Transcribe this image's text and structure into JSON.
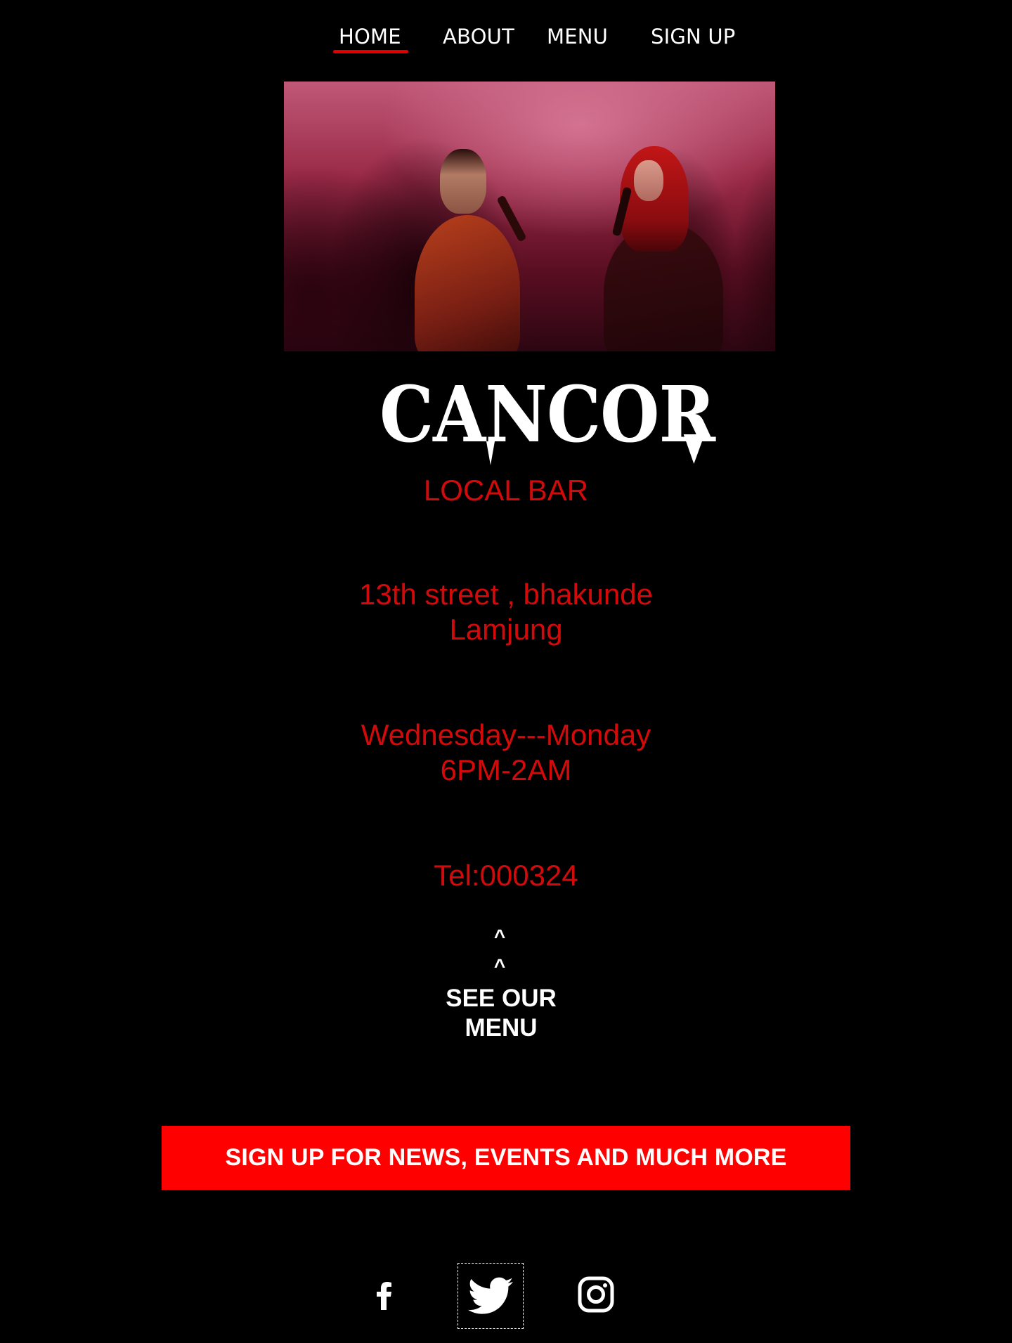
{
  "nav": {
    "items": [
      {
        "label": "HOME",
        "active": true
      },
      {
        "label": "ABOUT"
      },
      {
        "label": "MENU"
      },
      {
        "label": "SIGN UP"
      }
    ],
    "active_color": "#e00000"
  },
  "hero": {
    "image": "photo-people-drinking-at-red-lit-bar"
  },
  "brand": {
    "name": "CANCOR",
    "subtitle": "LOCAL BAR"
  },
  "info": {
    "address_line1": "13th street , bhakunde",
    "address_line2": "Lamjung",
    "days": "Wednesday---Monday",
    "hours": "6PM-2AM",
    "tel": "Tel:000324"
  },
  "see_menu": {
    "caret": "^",
    "label": "SEE OUR\nMENU"
  },
  "signup": {
    "label": "SIGN UP FOR NEWS, EVENTS AND MUCH MORE",
    "color": "#ff0000"
  },
  "social": {
    "icons": [
      "facebook-icon",
      "twitter-icon",
      "instagram-icon"
    ]
  },
  "colors": {
    "background": "#000000",
    "accent_text": "#d40a0a",
    "primary_text": "#ffffff"
  }
}
